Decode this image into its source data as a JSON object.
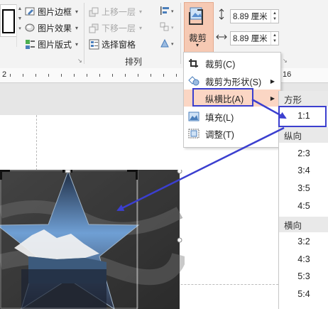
{
  "ribbon": {
    "picture_border": "图片边框",
    "picture_effects": "图片效果",
    "picture_layout": "图片版式",
    "bring_forward": "上移一层",
    "send_backward": "下移一层",
    "selection_pane": "选择窗格",
    "arrange_label": "排列",
    "crop_label": "裁剪",
    "height_value": "8.89 厘米",
    "width_value": "8.89 厘米"
  },
  "ruler": {
    "left_number": "2",
    "right_number": "16"
  },
  "crop_menu": {
    "items": [
      "裁剪(C)",
      "裁剪为形状(S)",
      "纵横比(A)",
      "填充(L)",
      "调整(T)"
    ]
  },
  "aspect_submenu": {
    "square_header": "方形",
    "square_items": [
      "1:1"
    ],
    "portrait_header": "纵向",
    "portrait_items": [
      "2:3",
      "3:4",
      "3:5",
      "4:5"
    ],
    "landscape_header": "横向",
    "landscape_items": [
      "3:2",
      "4:3",
      "5:3",
      "5:4"
    ]
  },
  "colors": {
    "highlight_bg": "#fbd6c4",
    "annotation_blue": "#3b3fcf",
    "crop_button_bg": "#f6c9b3"
  }
}
